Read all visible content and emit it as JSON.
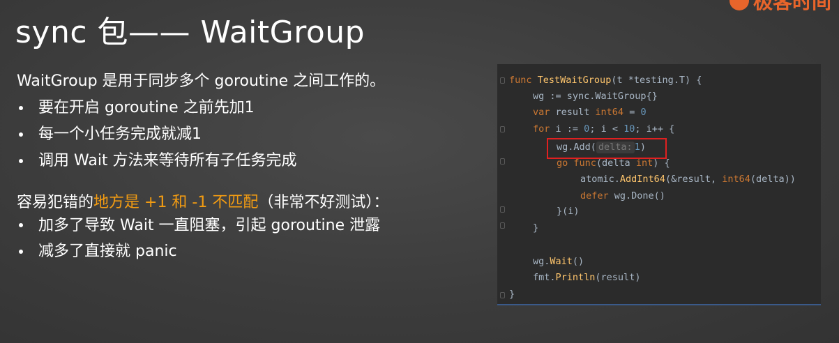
{
  "title": "sync 包—— WaitGroup",
  "logo": {
    "text": "极客时间",
    "brand_color": "#e8652b"
  },
  "intro": "WaitGroup 是用于同步多个 goroutine 之间工作的。",
  "bullets1": [
    "要在开启 goroutine 之前先加1",
    "每一个小任务完成就减1",
    "调用 Wait 方法来等待所有子任务完成"
  ],
  "error_intro": {
    "prefix": "容易犯错的",
    "highlight": "地方是 +1 和 -1 不匹配",
    "suffix": "（非常不好测试）：",
    "highlight_color": "#f39c12"
  },
  "bullets2": [
    "加多了导致 Wait 一直阻塞，引起 goroutine 泄露",
    "减多了直接就 panic"
  ],
  "code": {
    "l1": {
      "kw": "func",
      "name": "TestWaitGroup",
      "rest": "(t *testing.T) {"
    },
    "l2": {
      "a": "wg := sync.",
      "b": "WaitGroup",
      "c": "{}"
    },
    "l3": {
      "kw": "var",
      "a": " result ",
      "ty": "int64",
      "b": " = ",
      "num": "0"
    },
    "l4": {
      "kw": "for",
      "a": " i := ",
      "n1": "0",
      "b": "; i < ",
      "n2": "10",
      "c": "; i++ {"
    },
    "l5": {
      "a": "wg.Add(",
      "hint": "delta:",
      "num": "1",
      "b": ")"
    },
    "l6": {
      "kw": "go",
      "kw2": "func",
      "a": "(delta ",
      "ty": "int",
      "b": ") {"
    },
    "l7": {
      "a": "atomic.",
      "fn": "AddInt64",
      "b": "(&result, ",
      "kw": "int64",
      "c": "(delta))"
    },
    "l8": {
      "kw": "defer",
      "a": " wg.Done()"
    },
    "l9": "}(i)",
    "l10": "}",
    "l11": {
      "a": "wg.",
      "fn": "Wait",
      "b": "()"
    },
    "l12": {
      "a": "fmt.",
      "fn": "Println",
      "b": "(result)"
    },
    "l13": "}"
  }
}
